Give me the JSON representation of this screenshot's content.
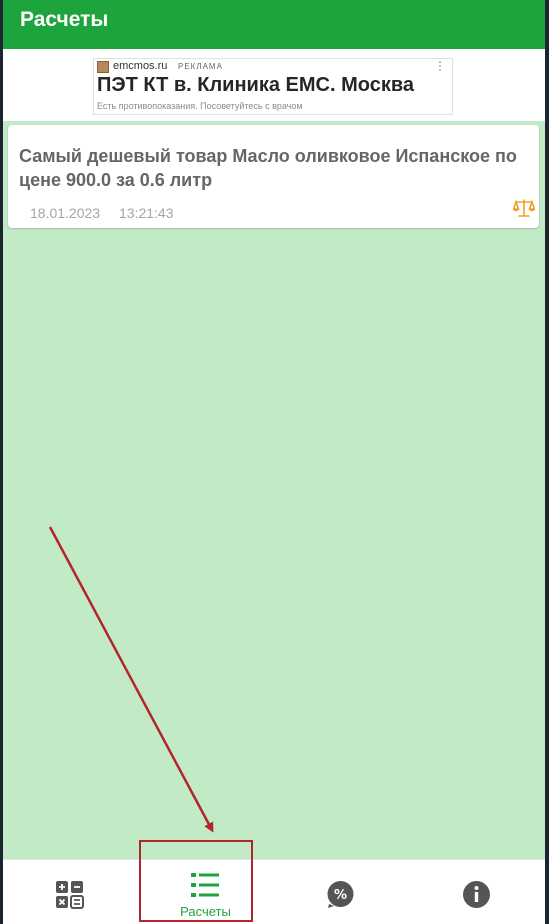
{
  "appbar": {
    "title": "Расчеты"
  },
  "ad": {
    "domain": "emcmos.ru",
    "tag": "РЕКЛАМА",
    "menu": "⋮",
    "title": "ПЭТ КТ в. Клиника ЕМС. Москва",
    "disclaimer": "Есть противопоказания. Посоветуйтесь с врачом"
  },
  "cards": [
    {
      "title": "Самый дешевый товар Масло оливковое Испанское по цене 900.0 за 0.6 литр",
      "date": "18.01.2023",
      "time": "13:21:43",
      "icon": "scales-icon"
    }
  ],
  "bottom_nav": {
    "items": [
      {
        "icon": "calculator-icon",
        "label": ""
      },
      {
        "icon": "list-icon",
        "label": "Расчеты",
        "active": true
      },
      {
        "icon": "percent-icon",
        "label": ""
      },
      {
        "icon": "info-icon",
        "label": ""
      }
    ]
  },
  "colors": {
    "primary": "#1ea43c",
    "background": "#c3eac6",
    "accent_icon": "#f0a020",
    "annotation": "#b1262b"
  }
}
